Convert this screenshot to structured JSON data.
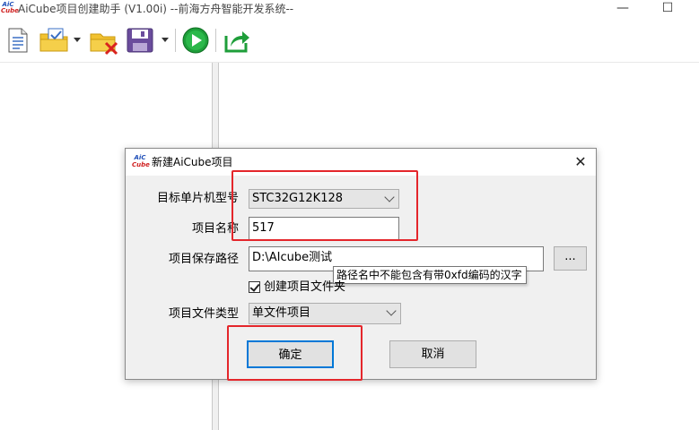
{
  "window": {
    "title": "AiCube项目创建助手 (V1.00i) --前海方舟智能开发系统--",
    "logo_top": "AiC",
    "logo_bottom": "Cube",
    "minimize": "—",
    "maximize": "☐"
  },
  "toolbar": {
    "buttons": [
      "new-document-icon",
      "open-project-icon",
      "close-project-icon",
      "save-icon",
      "run-icon",
      "export-icon"
    ]
  },
  "dialog": {
    "title": "新建AiCube项目",
    "close": "✕",
    "mcu_label": "目标单片机型号",
    "mcu_value": "STC32G12K128",
    "name_label": "项目名称",
    "name_value": "517",
    "path_label": "项目保存路径",
    "path_value": "D:\\AIcube测试",
    "browse_label": "...",
    "tooltip": "路径名中不能包含有带0xfd编码的汉字",
    "create_folder_label": "创建项目文件夹",
    "create_folder_checked": true,
    "type_label": "项目文件类型",
    "type_value": "单文件项目",
    "ok_label": "确定",
    "cancel_label": "取消"
  },
  "colors": {
    "annotation": "#e4262b",
    "run_green": "#1e9e3a",
    "folder_yellow": "#f2c230",
    "save_purple": "#6a4c9c"
  }
}
